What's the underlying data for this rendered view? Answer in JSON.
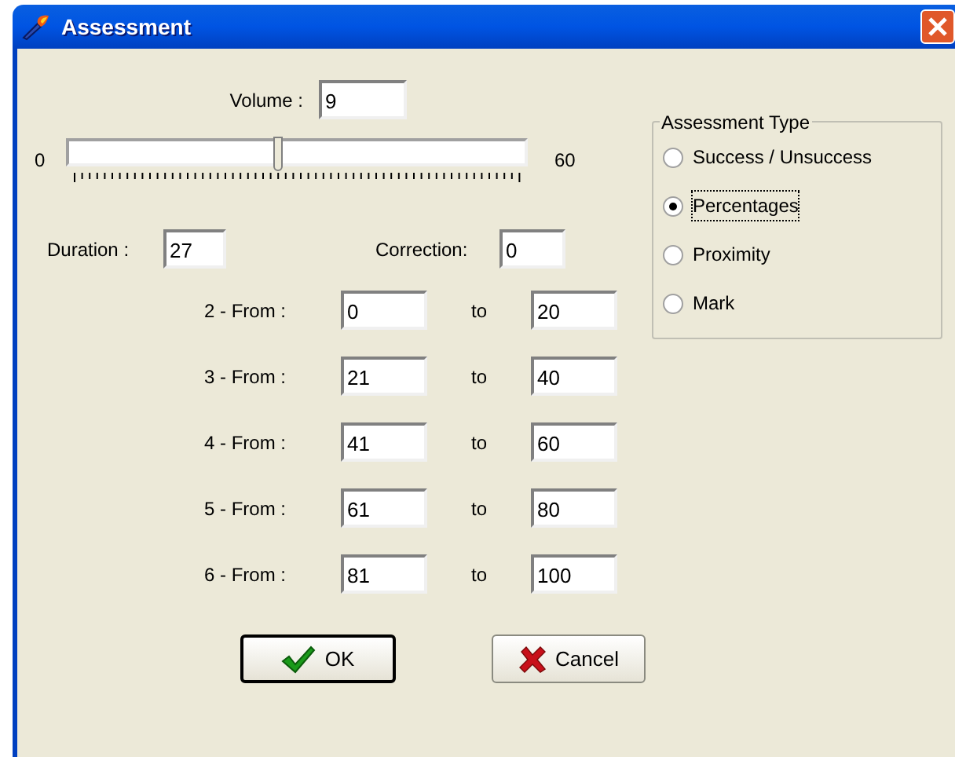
{
  "window": {
    "title": "Assessment"
  },
  "volume": {
    "label": "Volume :",
    "value": "9"
  },
  "slider": {
    "min_label": "0",
    "max_label": "60",
    "level": 0.46
  },
  "duration": {
    "label": "Duration :",
    "value": "27"
  },
  "correction": {
    "label": "Correction:",
    "value": "0"
  },
  "ranges": [
    {
      "label": "2 - From :",
      "from": "0",
      "to_label": "to",
      "to": "20"
    },
    {
      "label": "3 - From :",
      "from": "21",
      "to_label": "to",
      "to": "40"
    },
    {
      "label": "4 - From :",
      "from": "41",
      "to_label": "to",
      "to": "60"
    },
    {
      "label": "5 - From :",
      "from": "61",
      "to_label": "to",
      "to": "80"
    },
    {
      "label": "6 - From :",
      "from": "81",
      "to_label": "to",
      "to": "100"
    }
  ],
  "assessment_type": {
    "title": "Assessment Type",
    "options": [
      {
        "label": "Success / Unsuccess",
        "selected": false
      },
      {
        "label": "Percentages",
        "selected": true
      },
      {
        "label": "Proximity",
        "selected": false
      },
      {
        "label": "Mark",
        "selected": false
      }
    ]
  },
  "buttons": [
    {
      "kind": "ok",
      "label": "OK",
      "default": true
    },
    {
      "kind": "cancel",
      "label": "Cancel",
      "default": false
    }
  ]
}
